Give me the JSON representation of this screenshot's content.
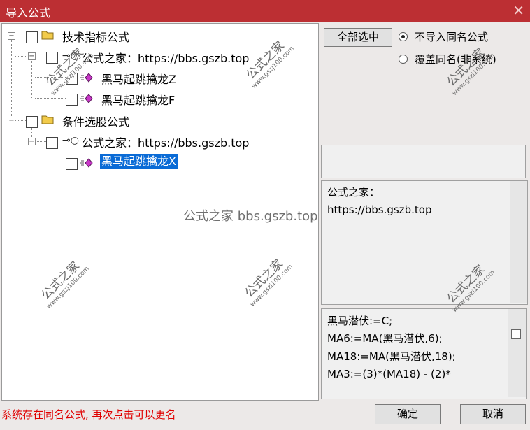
{
  "window": {
    "title": "导入公式",
    "close_glyph": "✕"
  },
  "tree": {
    "group1": "技术指标公式",
    "group1_sub": "公式之家：https://bbs.gszb.top",
    "group1_items": [
      "黑马起跳擒龙Z",
      "黑马起跳擒龙F"
    ],
    "group2": "条件选股公式",
    "group2_sub": "公式之家：https://bbs.gszb.top",
    "group2_items": [
      "黑马起跳擒龙X"
    ]
  },
  "actions": {
    "select_all": "全部选中",
    "confirm": "确定",
    "cancel": "取消"
  },
  "options": {
    "no_import": "不导入同名公式",
    "overwrite": "覆盖同名(非系统)",
    "selected": "no_import"
  },
  "info_panel": {
    "line1": "公式之家：",
    "line2": "https://bbs.gszb.top"
  },
  "code_panel": {
    "lines": [
      "黑马潜伏:=C;",
      "MA6:=MA(黑马潜伏,6);",
      "MA18:=MA(黑马潜伏,18);",
      "MA3:=(3)*(MA18) - (2)*"
    ]
  },
  "status": "系统存在同名公式, 再次点击可以更名",
  "watermark": {
    "main": "公式之家",
    "site": "www.gszj100.com",
    "center": "公式之家 bbs.gszb.top"
  }
}
